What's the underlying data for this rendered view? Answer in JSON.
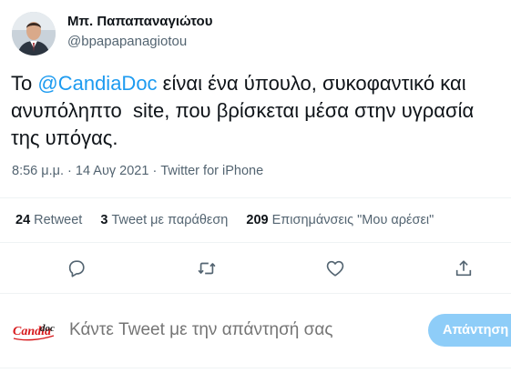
{
  "author": {
    "name": "Μπ. Παπαπαναγιώτου",
    "handle": "@bpapapanagiotou"
  },
  "tweet": {
    "text_before": "Το ",
    "mention": "@CandiaDoc",
    "text_after": " είναι ένα ύπουλο, συκοφαντικό και ανυπόληπτο  site, που βρίσκεται μέσα στην υγρασία της υπόγας."
  },
  "meta": {
    "time": "8:56 μ.μ.",
    "sep1": " · ",
    "date": "14 Αυγ 2021",
    "sep2": " · ",
    "source": "Twitter for iPhone"
  },
  "stats": {
    "retweets_count": "24",
    "retweets_label": "Retweet",
    "quotes_count": "3",
    "quotes_label": "Tweet με παράθεση",
    "likes_count": "209",
    "likes_label": "Επισημάνσεις \"Μου αρέσει\""
  },
  "reply": {
    "logo_text_1": "Candia",
    "logo_text_2": "doc",
    "placeholder": "Κάντε Tweet με την απάντησή σας",
    "button_label": "Απάντηση"
  },
  "colors": {
    "accent": "#1d9bf0",
    "secondary_text": "#536471",
    "reply_button": "#8ecdf8",
    "logo_red": "#d7191c"
  },
  "icons": [
    "reply-icon",
    "retweet-icon",
    "like-icon",
    "share-icon"
  ]
}
